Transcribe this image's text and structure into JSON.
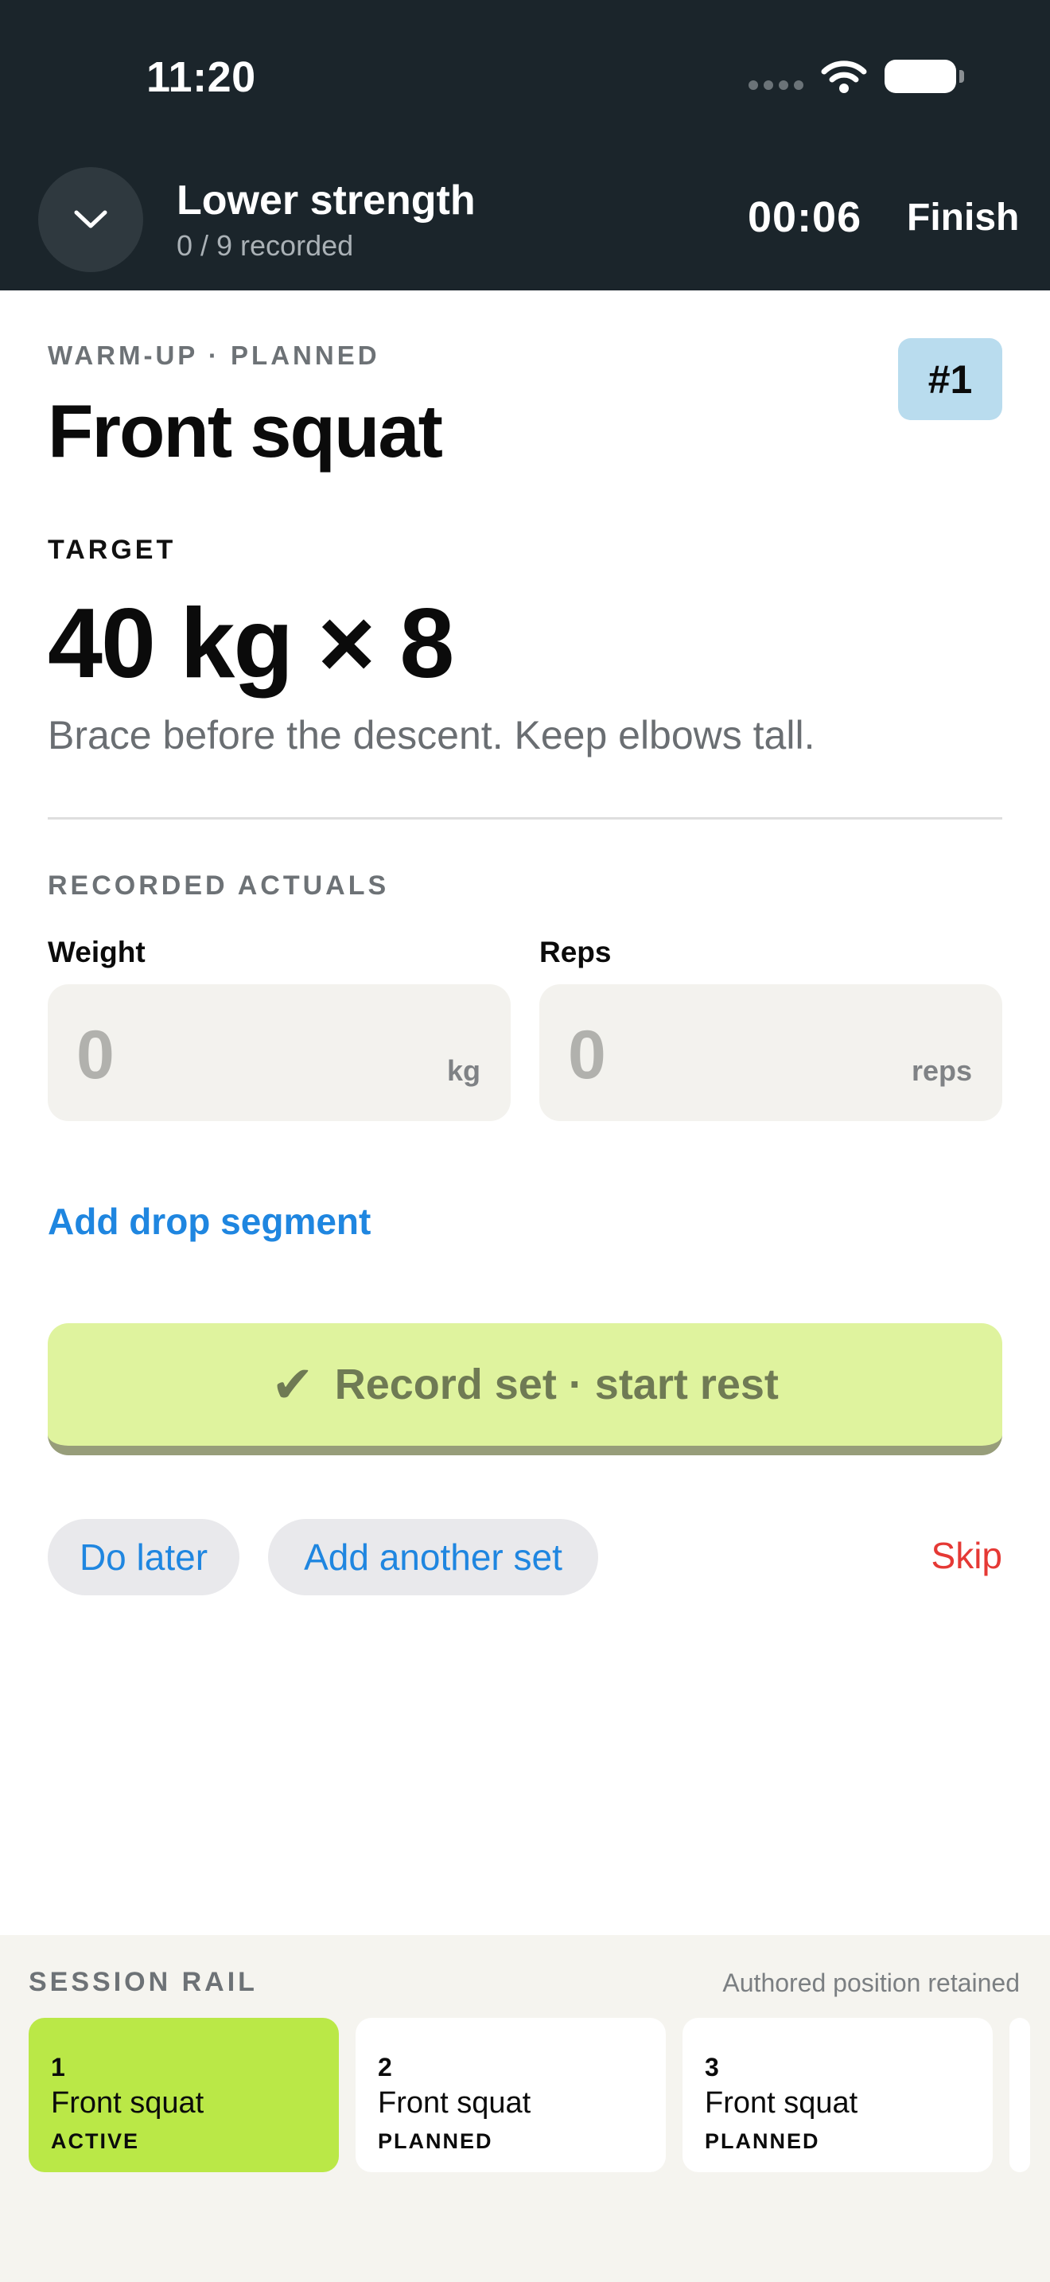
{
  "status_bar": {
    "time": "11:20"
  },
  "header": {
    "title": "Lower strength",
    "subtitle": "0 / 9 recorded",
    "timer": "00:06",
    "finish_label": "Finish"
  },
  "exercise": {
    "eyebrow": "WARM-UP · PLANNED",
    "badge": "#1",
    "name": "Front squat",
    "target_label": "TARGET",
    "target_value": "40 kg × 8",
    "cue": "Brace before the descent. Keep elbows tall."
  },
  "actuals": {
    "label": "RECORDED ACTUALS",
    "weight": {
      "label": "Weight",
      "value": "0",
      "unit": "kg"
    },
    "reps": {
      "label": "Reps",
      "value": "0",
      "unit": "reps"
    }
  },
  "actions": {
    "drop_segment": "Add drop segment",
    "record": "Record set · start rest",
    "do_later": "Do later",
    "add_set": "Add another set",
    "skip": "Skip"
  },
  "rail": {
    "title": "SESSION RAIL",
    "note": "Authored position retained",
    "items": [
      {
        "number": "1",
        "name": "Front squat",
        "state": "ACTIVE"
      },
      {
        "number": "2",
        "name": "Front squat",
        "state": "PLANNED"
      },
      {
        "number": "3",
        "name": "Front squat",
        "state": "PLANNED"
      }
    ]
  },
  "colors": {
    "header_bg": "#1b252b",
    "accent_blue": "#1f86e0",
    "record_bg": "#dff39e",
    "active_card": "#bae847",
    "skip_red": "#e53935",
    "badge_bg": "#b9dcee"
  }
}
